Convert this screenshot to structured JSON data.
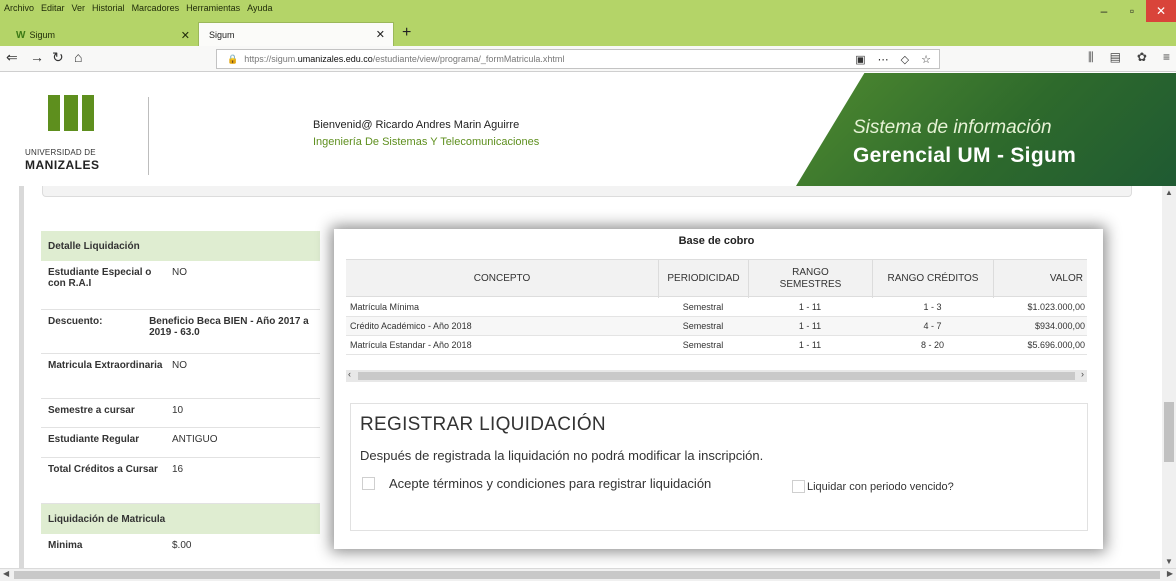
{
  "browser": {
    "menu": [
      "Archivo",
      "Editar",
      "Ver",
      "Historial",
      "Marcadores",
      "Herramientas",
      "Ayuda"
    ],
    "tabs": [
      {
        "title": "Sigum",
        "active": false
      },
      {
        "title": "Sigum",
        "active": true
      }
    ],
    "url_prefix": "https://sigum.",
    "url_domain": "umanizales.edu.co",
    "url_path": "/estudiante/view/programa/_formMatricula.xhtml",
    "accent_color": "#b4d468"
  },
  "header": {
    "logo_line1": "UNIVERSIDAD DE",
    "logo_line2": "MANIZALES",
    "welcome": "Bienvenid@ Ricardo Andres Marin Aguirre",
    "program": "Ingeniería De Sistemas Y Telecomunicaciones",
    "banner_line1": "Sistema de información",
    "banner_line2": "Gerencial UM - Sigum",
    "brand_color": "#5e8f1e"
  },
  "detail": {
    "title": "Detalle Liquidación",
    "rows": [
      {
        "label": "Estudiante Especial o con R.A.I",
        "value": "NO"
      },
      {
        "label": "Descuento:",
        "value": "Beneficio Beca BIEN - Año 2017 a 2019 - 63.0"
      },
      {
        "label": "Matricula Extraordinaria",
        "value": "NO"
      },
      {
        "label": "Semestre a cursar",
        "value": "10"
      },
      {
        "label": "Estudiante Regular",
        "value": "ANTIGUO"
      },
      {
        "label": "Total Créditos a Cursar",
        "value": "16"
      }
    ],
    "section2_title": "Liquidación de Matricula",
    "rows2": [
      {
        "label": "Minima",
        "value": "$.00"
      }
    ]
  },
  "modal": {
    "table_title": "Base de cobro",
    "columns": [
      "CONCEPTO",
      "PERIODICIDAD",
      "RANGO SEMESTRES",
      "RANGO CRÉDITOS",
      "VALOR"
    ],
    "rows": [
      {
        "concepto": "Matrícula Mínima",
        "periodicidad": "Semestral",
        "semestres": "1 - 11",
        "creditos": "1 - 3",
        "valor": "$1.023.000,00"
      },
      {
        "concepto": "Crédito Académico - Año 2018",
        "periodicidad": "Semestral",
        "semestres": "1 - 11",
        "creditos": "4 - 7",
        "valor": "$934.000,00"
      },
      {
        "concepto": "Matrícula Estandar - Año 2018",
        "periodicidad": "Semestral",
        "semestres": "1 - 11",
        "creditos": "8 - 20",
        "valor": "$5.696.000,00"
      }
    ],
    "register_title": "REGISTRAR LIQUIDACIÓN",
    "register_note": "Después de registrada la liquidación no podrá modificar la inscripción.",
    "accept_terms_label": "Acepte términos y condiciones para registrar liquidación",
    "expired_period_label": "Liquidar con periodo vencido?"
  }
}
